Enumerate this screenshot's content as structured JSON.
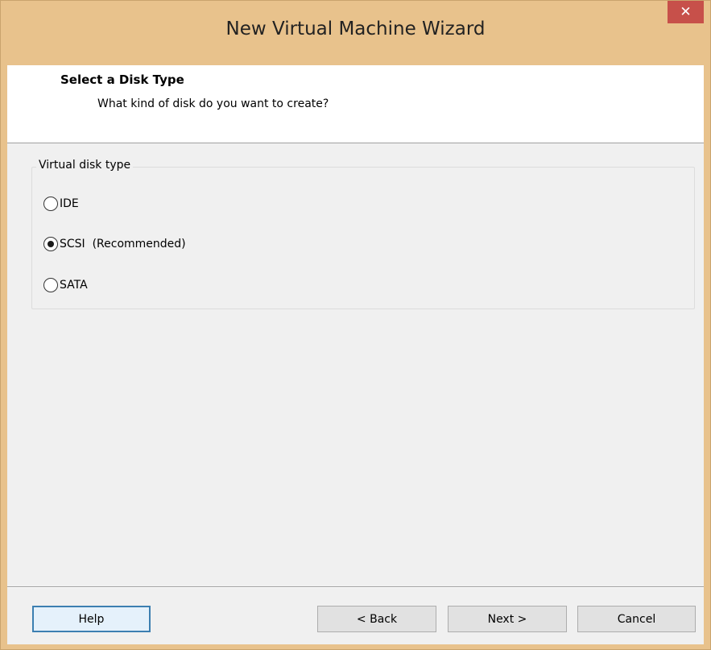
{
  "window": {
    "title": "New Virtual Machine Wizard",
    "close_glyph": "✕"
  },
  "header": {
    "title": "Select a Disk Type",
    "subtitle": "What kind of disk do you want to create?"
  },
  "disk_type_group": {
    "label": "Virtual disk type",
    "options": [
      {
        "label": "IDE",
        "selected": false
      },
      {
        "label": "SCSI  (Recommended)",
        "selected": true
      },
      {
        "label": "SATA",
        "selected": false
      }
    ]
  },
  "buttons": {
    "help": "Help",
    "back": "< Back",
    "next": "Next >",
    "cancel": "Cancel"
  },
  "colors": {
    "frame": "#e8c28c",
    "close_button": "#c7504a",
    "default_button_border": "#3c7fb1"
  },
  "icons": {
    "close": "close-icon"
  }
}
